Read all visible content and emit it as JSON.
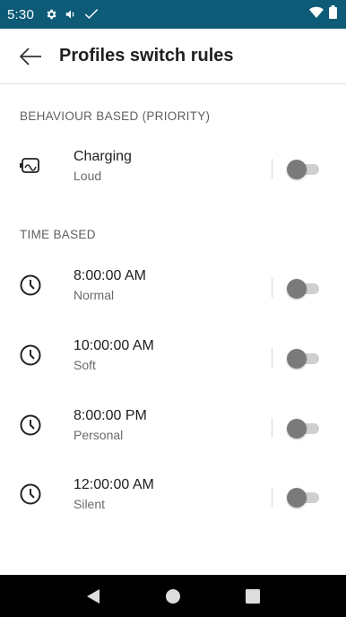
{
  "status_bar": {
    "time": "5:30",
    "icons": [
      "gear-icon",
      "volume-icon",
      "check-icon"
    ],
    "right_icons": [
      "wifi-icon",
      "battery-icon"
    ],
    "background": "#0e5b78"
  },
  "app_bar": {
    "title": "Profiles switch rules",
    "back_icon": "arrow-left-icon"
  },
  "sections": {
    "behaviour": {
      "heading": "BEHAVIOUR BASED (PRIORITY)",
      "rules": [
        {
          "icon": "charging-icon",
          "title": "Charging",
          "profile": "Loud",
          "enabled": false
        }
      ]
    },
    "time": {
      "heading": "TIME BASED",
      "rules": [
        {
          "icon": "clock-icon",
          "title": "8:00:00 AM",
          "profile": "Normal",
          "enabled": false
        },
        {
          "icon": "clock-icon",
          "title": "10:00:00 AM",
          "profile": "Soft",
          "enabled": false
        },
        {
          "icon": "clock-icon",
          "title": "8:00:00 PM",
          "profile": "Personal",
          "enabled": false
        },
        {
          "icon": "clock-icon",
          "title": "12:00:00 AM",
          "profile": "Silent",
          "enabled": false
        }
      ]
    }
  },
  "nav_bar": {
    "buttons": [
      "back-triangle-icon",
      "home-circle-icon",
      "recents-square-icon"
    ]
  }
}
